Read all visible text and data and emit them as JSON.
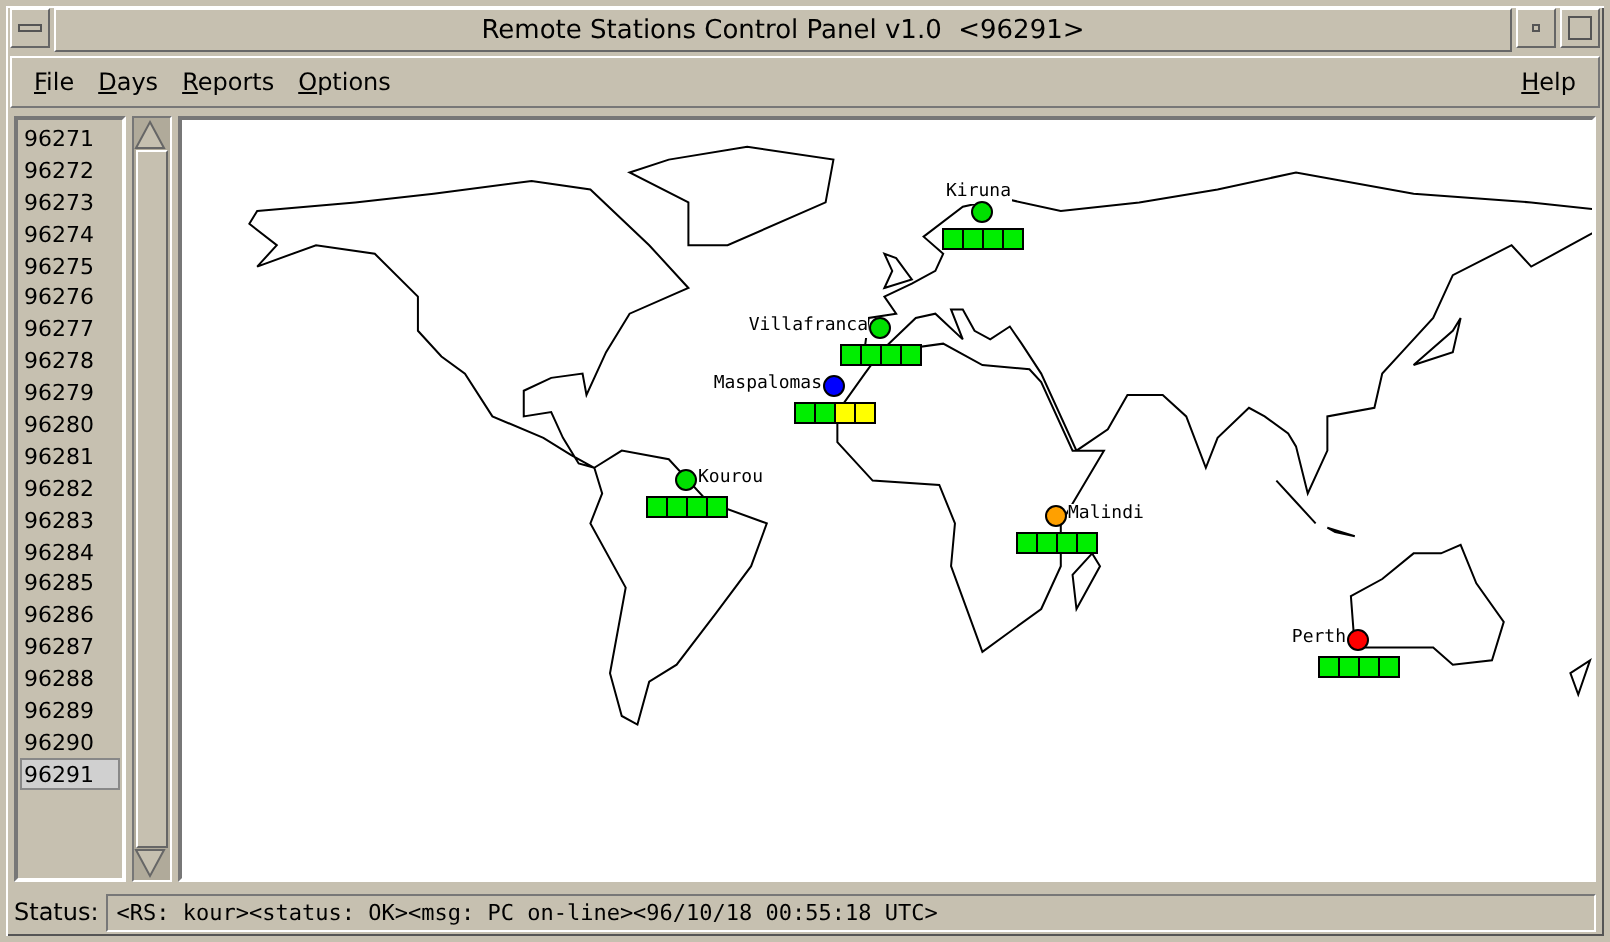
{
  "window": {
    "title": "Remote Stations Control Panel v1.0  <96291>"
  },
  "menu": [
    {
      "label": "File"
    },
    {
      "label": "Days"
    },
    {
      "label": "Reports"
    },
    {
      "label": "Options"
    }
  ],
  "help_menu": {
    "label": "Help"
  },
  "days": [
    {
      "label": "96271",
      "selected": false
    },
    {
      "label": "96272",
      "selected": false
    },
    {
      "label": "96273",
      "selected": false
    },
    {
      "label": "96274",
      "selected": false
    },
    {
      "label": "96275",
      "selected": false
    },
    {
      "label": "96276",
      "selected": false
    },
    {
      "label": "96277",
      "selected": false
    },
    {
      "label": "96278",
      "selected": false
    },
    {
      "label": "96279",
      "selected": false
    },
    {
      "label": "96280",
      "selected": false
    },
    {
      "label": "96281",
      "selected": false
    },
    {
      "label": "96282",
      "selected": false
    },
    {
      "label": "96283",
      "selected": false
    },
    {
      "label": "96284",
      "selected": false
    },
    {
      "label": "96285",
      "selected": false
    },
    {
      "label": "96286",
      "selected": false
    },
    {
      "label": "96287",
      "selected": false
    },
    {
      "label": "96288",
      "selected": false
    },
    {
      "label": "96289",
      "selected": false
    },
    {
      "label": "96290",
      "selected": false
    },
    {
      "label": "96291",
      "selected": true
    }
  ],
  "stations": [
    {
      "name": "Kiruna",
      "color": "#00e000",
      "cells": [
        {
          "color": "#00ee00"
        },
        {
          "color": "#00ee00"
        },
        {
          "color": "#00ee00"
        },
        {
          "color": "#00ee00"
        }
      ]
    },
    {
      "name": "Villafranca",
      "color": "#00e000",
      "cells": [
        {
          "color": "#00ee00"
        },
        {
          "color": "#00ee00"
        },
        {
          "color": "#00ee00"
        },
        {
          "color": "#00ee00"
        }
      ]
    },
    {
      "name": "Maspalomas",
      "color": "#0000ff",
      "cells": [
        {
          "color": "#00ee00"
        },
        {
          "color": "#00ee00"
        },
        {
          "color": "#ffff00"
        },
        {
          "color": "#ffff00"
        }
      ]
    },
    {
      "name": "Kourou",
      "color": "#00e000",
      "cells": [
        {
          "color": "#00ee00"
        },
        {
          "color": "#00ee00"
        },
        {
          "color": "#00ee00"
        },
        {
          "color": "#00ee00"
        }
      ]
    },
    {
      "name": "Malindi",
      "color": "#ffa000",
      "cells": [
        {
          "color": "#00ee00"
        },
        {
          "color": "#00ee00"
        },
        {
          "color": "#00ee00"
        },
        {
          "color": "#00ee00"
        }
      ]
    },
    {
      "name": "Perth",
      "color": "#ff0000",
      "cells": [
        {
          "color": "#00ee00"
        },
        {
          "color": "#00ee00"
        },
        {
          "color": "#00ee00"
        },
        {
          "color": "#00ee00"
        }
      ]
    }
  ],
  "status_bar": {
    "label": "Status:",
    "message": "<RS: kour><status: OK><msg: PC on-line><96/10/18 00:55:18 UTC>"
  }
}
